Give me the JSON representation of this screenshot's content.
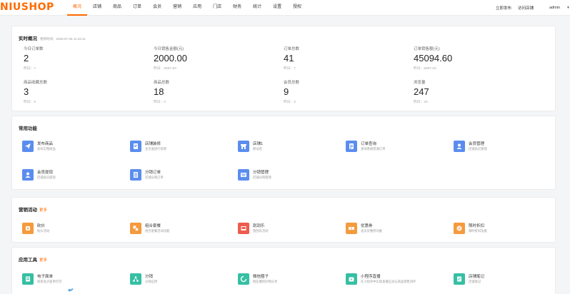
{
  "header": {
    "logo": "NIUSHOP",
    "nav": [
      "概况",
      "店铺",
      "商品",
      "订单",
      "会员",
      "营销",
      "应用",
      "门店",
      "财务",
      "统计",
      "设置",
      "授权"
    ],
    "active_index": 0,
    "right": {
      "publish": "立即发布",
      "visit": "访问店铺",
      "user": "admin"
    }
  },
  "realtime": {
    "title": "实时概况",
    "update_time": "更新时间：2020-07-25 11:43:11",
    "stats": [
      {
        "label": "今日订单数",
        "value": "2",
        "sub": "昨日：7"
      },
      {
        "label": "今日销售金额(元)",
        "value": "2000.00",
        "sub": "昨日：8987.60"
      },
      {
        "label": "订单总数",
        "value": "41",
        "sub": "昨日：7"
      },
      {
        "label": "订单销售额(元)",
        "value": "45094.60",
        "sub": "昨日：8987.60"
      },
      {
        "label": "商品收藏总数",
        "value": "3",
        "sub": "昨日：5"
      },
      {
        "label": "商品总数",
        "value": "18",
        "sub": "昨日：0"
      },
      {
        "label": "会员总数",
        "value": "9",
        "sub": "昨日：0"
      },
      {
        "label": "浏览量",
        "value": "247",
        "sub": "昨日：29"
      }
    ]
  },
  "common": {
    "title": "常用功能",
    "items": [
      {
        "title": "发布商品",
        "desc": "发布实物商品",
        "icon": "send-icon",
        "color": "blue"
      },
      {
        "title": "店铺装修",
        "desc": "主页面进行装修",
        "icon": "decorate-icon",
        "color": "blue"
      },
      {
        "title": "店铺1",
        "desc": "移动店",
        "icon": "store-icon",
        "color": "blue"
      },
      {
        "title": "订单查询",
        "desc": "查询系统普通订单",
        "icon": "order-icon",
        "color": "blue"
      },
      {
        "title": "会员管理",
        "desc": "店铺会员管理",
        "icon": "member-icon",
        "color": "blue"
      },
      {
        "title": "会员提现",
        "desc": "店铺会员提现",
        "icon": "withdraw-icon",
        "color": "blue"
      },
      {
        "title": "分销订单",
        "desc": "店铺分销订单",
        "icon": "list-icon",
        "color": "blue"
      },
      {
        "title": "分销管理",
        "desc": "店铺分销管理",
        "icon": "distribution-icon",
        "color": "blue"
      }
    ]
  },
  "marketing": {
    "title": "营销活动",
    "more": "更多",
    "items": [
      {
        "title": "砍价",
        "desc": "砍价活动",
        "icon": "bargain-icon",
        "color": "orange"
      },
      {
        "title": "组合套餐",
        "desc": "组合套餐活动功能",
        "icon": "combo-icon",
        "color": "orange"
      },
      {
        "title": "刮刮乐",
        "desc": "刮刮乐活动",
        "icon": "scratch-icon",
        "color": "red"
      },
      {
        "title": "优惠券",
        "desc": "会员优惠券功能",
        "icon": "coupon-icon",
        "color": "orange"
      },
      {
        "title": "限时折扣",
        "desc": "限时折扣功能",
        "icon": "discount-icon",
        "color": "orange"
      }
    ]
  },
  "tools": {
    "title": "应用工具",
    "more": "更多",
    "items": [
      {
        "title": "电子面单",
        "desc": "商家电子面单打印",
        "icon": "waybill-icon",
        "color": "green"
      },
      {
        "title": "分销",
        "desc": "分销应用",
        "icon": "share-icon",
        "color": "green"
      },
      {
        "title": "微信圈子",
        "desc": "朋友圈的好物分享",
        "icon": "circle-icon",
        "color": "green"
      },
      {
        "title": "小程序直播",
        "desc": "在小程序中实现直播互动与商品销售闭环",
        "icon": "live-icon",
        "color": "green"
      },
      {
        "title": "店铺笔记",
        "desc": "店铺笔记",
        "icon": "note-icon",
        "color": "green"
      }
    ]
  }
}
